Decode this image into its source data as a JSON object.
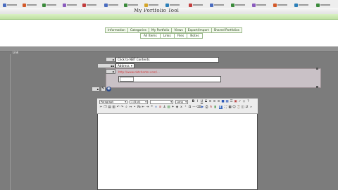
{
  "page": {
    "title": "My Portfolio Tool"
  },
  "nav": {
    "items": [
      "Information",
      "Categories",
      "My Portfolio",
      "Views",
      "Export/Import",
      "Shared Portfolios"
    ]
  },
  "subnav": {
    "items": [
      "All Items",
      "Links",
      "Files",
      "Notes"
    ]
  },
  "panel": {
    "label": "Link"
  },
  "form": {
    "title_value": "Click to NBT Contents",
    "type_value": "Address",
    "url_value": "http://www.nbtcharter.com/..."
  },
  "editor": {
    "style_select": "Paragraph",
    "format_select": "1 (8 pt)",
    "font_select": "",
    "lang_select": "Lang"
  },
  "colors": {
    "background": "#7c7c7c",
    "accent_green": "#bfe0a2",
    "link_red": "#d43a3a"
  }
}
